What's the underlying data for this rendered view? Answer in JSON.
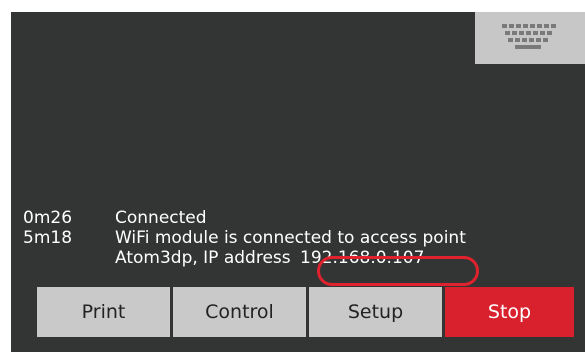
{
  "screen": {
    "keyboard_icon": "keyboard-icon",
    "background": "#333534"
  },
  "log": [
    {
      "time": "0m26",
      "message": "Connected"
    },
    {
      "time": "5m18",
      "message": "WiFi module is connected to access point"
    },
    {
      "time": "",
      "message_prefix": "Atom3dp, IP address ",
      "ip": "192.168.0.107"
    }
  ],
  "buttons": {
    "print_label": "Print",
    "control_label": "Control",
    "setup_label": "Setup",
    "stop_label": "Stop"
  },
  "colors": {
    "stop": "#d9202d",
    "highlight": "#e0222e",
    "button": "#c9c9c9"
  }
}
